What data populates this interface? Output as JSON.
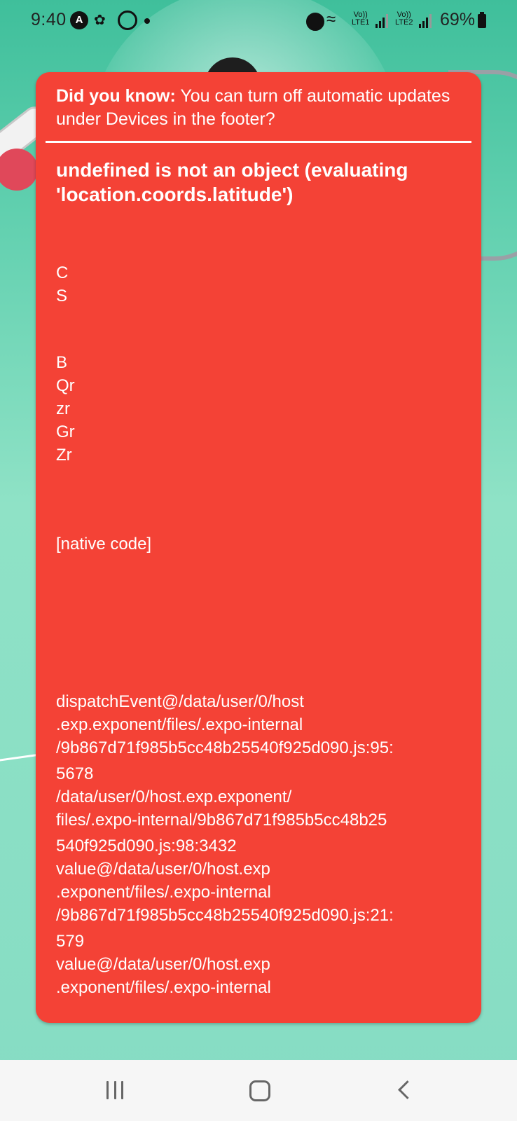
{
  "status_bar": {
    "time": "9:40",
    "notification_icons": [
      "a-circle-icon",
      "app-icon",
      "whatsapp-icon",
      "dot-icon"
    ],
    "alarm_icon": "alarm-icon",
    "wifi_icon": "wifi-icon",
    "sim1": {
      "volte": "Vo))",
      "network": "LTE1"
    },
    "sim2": {
      "volte": "Vo))",
      "network": "LTE2"
    },
    "battery_percent": "69%"
  },
  "error_card": {
    "background_color": "#f44236",
    "tip_label": "Did you know:",
    "tip_text": " You can turn off automatic updates under Devices in the footer?",
    "error_message": "undefined is not an object (evaluating 'location.coords.latitude')",
    "stack_trace": [
      "C",
      "S",
      "B",
      "Qr",
      "zr",
      "Gr",
      "Zr",
      "[native code]",
      "dispatchEvent@/data/user/0/host",
      ".exp.exponent/files/.expo-internal",
      "/9b867d71f985b5cc48b25540f925d090.js:95:",
      "5678",
      "/data/user/0/host.exp.exponent/",
      "files/.expo-internal/9b867d71f985b5cc48b25",
      "540f925d090.js:98:3432",
      "value@/data/user/0/host.exp",
      ".exponent/files/.expo-internal",
      "/9b867d71f985b5cc48b25540f925d090.js:21:",
      "579",
      "value@/data/user/0/host.exp",
      ".exponent/files/.expo-internal"
    ]
  },
  "nav_bar": {
    "recents_icon": "recents-icon",
    "home_icon": "home-icon",
    "back_icon": "back-icon"
  }
}
